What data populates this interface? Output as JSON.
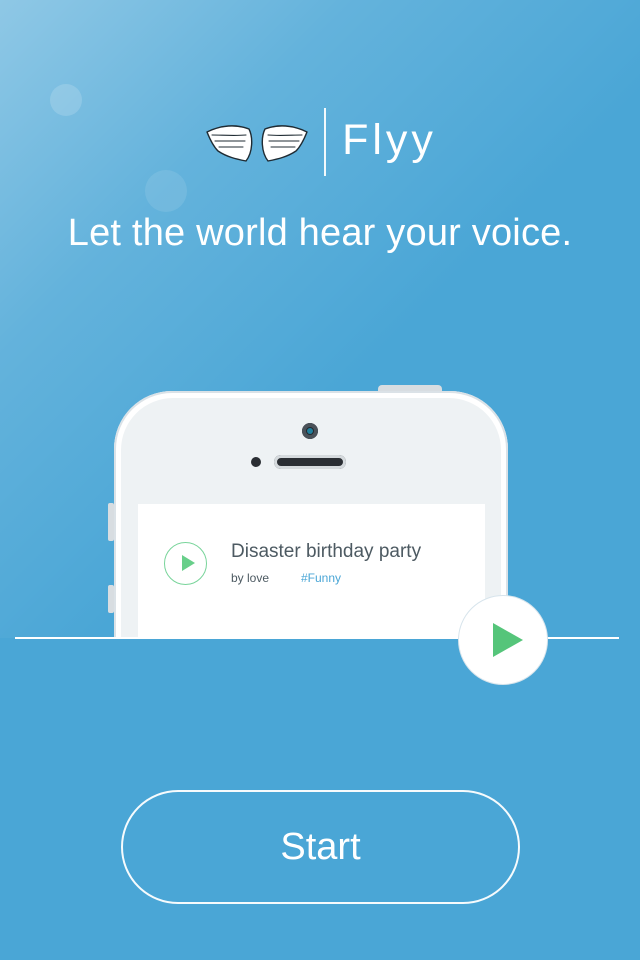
{
  "brand": {
    "name": "Flyy",
    "logo_icon": "wings-logo-icon"
  },
  "tagline": "Let the world hear your voice.",
  "preview_card": {
    "title": "Disaster birthday party",
    "author": "by love",
    "tag": "#Funny",
    "play_icon": "play-icon"
  },
  "controls": {
    "large_play_icon": "play-icon",
    "start_label": "Start"
  },
  "colors": {
    "background": "#4aa6d6",
    "accent_green": "#55c57a",
    "text_dark": "#4d5a62"
  }
}
